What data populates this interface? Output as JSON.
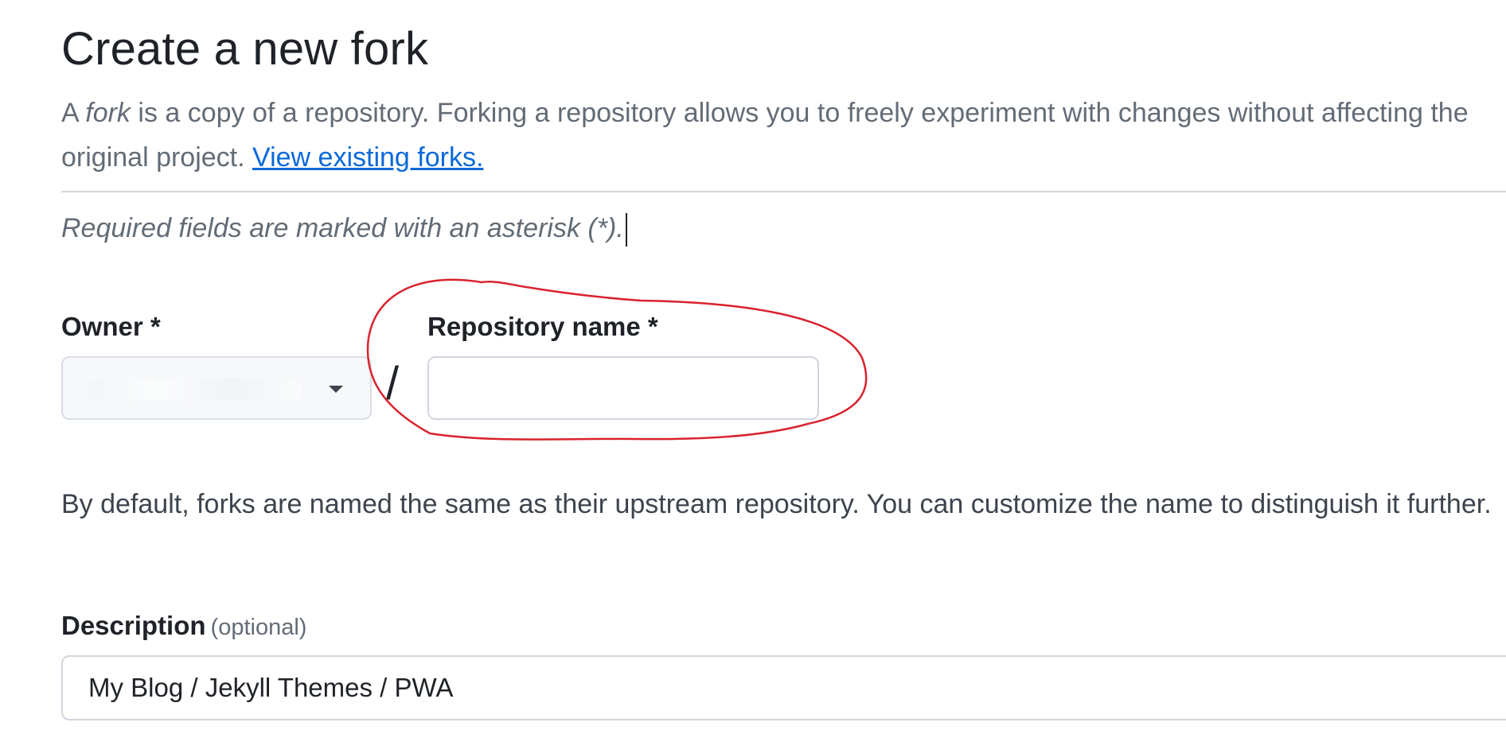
{
  "page": {
    "title": "Create a new fork"
  },
  "intro": {
    "text_before": "A ",
    "emphasis": "fork",
    "text_after": " is a copy of a repository. Forking a repository allows you to freely experiment with changes without affecting the original project. ",
    "link_label": "View existing forks."
  },
  "required_note": "Required fields are marked with an asterisk (*).",
  "owner": {
    "label": "Owner *",
    "value": ""
  },
  "separator": "/",
  "repository_name": {
    "label": "Repository name *",
    "value": "",
    "placeholder": ""
  },
  "annotation": {
    "color": "#d9232e"
  },
  "help_text": "By default, forks are named the same as their upstream repository. You can customize the name to distinguish it further.",
  "description": {
    "label": "Description",
    "optional_label": "(optional)",
    "value": "My Blog / Jekyll Themes / PWA"
  },
  "icons": {
    "owner_dropdown": "triangle-down-icon"
  }
}
